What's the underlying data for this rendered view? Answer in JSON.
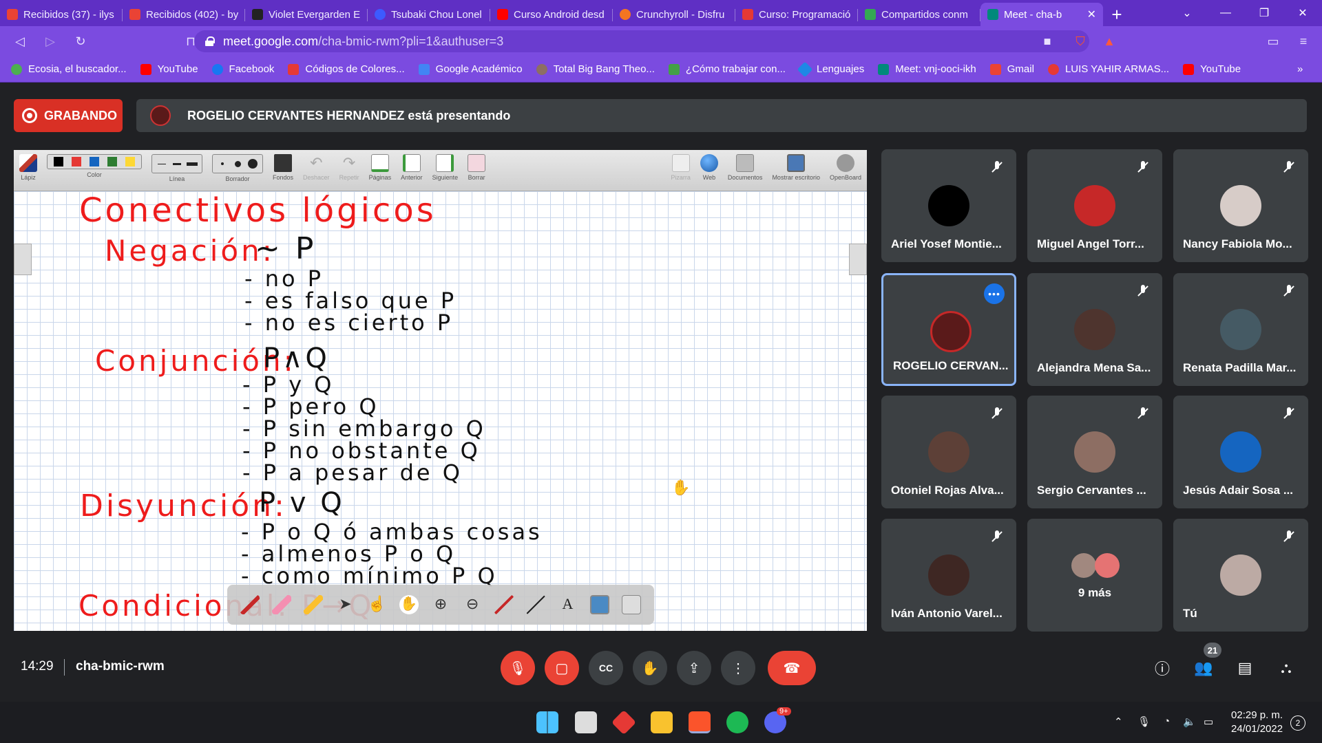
{
  "browser": {
    "tabs": [
      {
        "label": "Recibidos (37) - ilys",
        "color": "#ea4335"
      },
      {
        "label": "Recibidos (402) - by",
        "color": "#ea4335"
      },
      {
        "label": "Violet Evergarden E",
        "color": "#222222"
      },
      {
        "label": "Tsubaki Chou Lonel",
        "color": "#3d5afe"
      },
      {
        "label": "Curso Android desd",
        "color": "#ff0000"
      },
      {
        "label": "Crunchyroll - Disfru",
        "color": "#f47521"
      },
      {
        "label": "Curso: Programació",
        "color": "#e53935"
      },
      {
        "label": "Compartidos conm",
        "color": "#34a853"
      },
      {
        "label": "Meet - cha-b",
        "color": "#00897b",
        "active": true
      }
    ],
    "new_tab": "+",
    "url_host": "meet.google.com",
    "url_path": "/cha-bmic-rwm?pli=1&authuser=3",
    "bookmarks": [
      {
        "label": "Ecosia, el buscador...",
        "color": "#4caf50"
      },
      {
        "label": "YouTube",
        "color": "#ff0000"
      },
      {
        "label": "Facebook",
        "color": "#1877f2"
      },
      {
        "label": "Códigos de Colores...",
        "color": "#e53935"
      },
      {
        "label": "Google Académico",
        "color": "#4285f4"
      },
      {
        "label": "Total Big Bang Theo...",
        "color": "#8d6e63"
      },
      {
        "label": "¿Cómo trabajar con...",
        "color": "#43a047"
      },
      {
        "label": "Lenguajes",
        "color": "#1e88e5"
      },
      {
        "label": "Meet: vnj-ooci-ikh",
        "color": "#00897b"
      },
      {
        "label": "Gmail",
        "color": "#ea4335"
      },
      {
        "label": "LUIS YAHIR ARMAS...",
        "color": "#e53935"
      },
      {
        "label": "YouTube",
        "color": "#ff0000"
      }
    ],
    "more_bookmarks": "»"
  },
  "meet": {
    "recording_label": "GRABANDO",
    "presenting_text": "ROGELIO CERVANTES HERNANDEZ está presentando",
    "meeting_time": "14:29",
    "meeting_code": "cha-bmic-rwm",
    "participant_count": "21"
  },
  "openboard": {
    "tools": [
      {
        "label": "Lápiz"
      },
      {
        "label": "Color"
      },
      {
        "label": "Línea"
      },
      {
        "label": "Borrador"
      },
      {
        "label": "Fondos"
      },
      {
        "label": "Deshacer"
      },
      {
        "label": "Repetir"
      },
      {
        "label": "Páginas"
      },
      {
        "label": "Anterior"
      },
      {
        "label": "Siguiente"
      },
      {
        "label": "Borrar"
      }
    ],
    "right_tools": [
      {
        "label": "Pizarra"
      },
      {
        "label": "Web"
      },
      {
        "label": "Documentos"
      },
      {
        "label": "Mostrar escritorio"
      },
      {
        "label": "OpenBoard"
      }
    ],
    "colors": [
      "#000000",
      "#e53935",
      "#1565c0",
      "#2e7d32",
      "#fdd835"
    ]
  },
  "whiteboard": {
    "title": "Conectivos lógicos",
    "negacion": "Negación:",
    "negacion_sym": "∼ P",
    "neg_items": [
      "- no P",
      "- es falso que P",
      "- no es cierto P"
    ],
    "conjuncion": "Conjunción:",
    "conjuncion_sym": "P∧Q",
    "conj_items": [
      "- P y Q",
      "- P pero Q",
      "- P sin embargo Q",
      "- P no obstante Q",
      "- P a pesar de Q"
    ],
    "disyuncion": "Disyunción:",
    "disyuncion_sym": "P v Q",
    "disy_items": [
      "- P o Q ó ambas cosas",
      "- almenos P o Q",
      "- como mínimo P Q"
    ],
    "condicional": "Condicional: P→Q"
  },
  "participants": [
    {
      "name": "Ariel Yosef Montie...",
      "avatar_color": "#000000"
    },
    {
      "name": "Miguel Angel Torr...",
      "avatar_color": "#c62828"
    },
    {
      "name": "Nancy Fabiola Mo...",
      "avatar_color": "#d7ccc8"
    },
    {
      "name": "ROGELIO CERVAN...",
      "avatar_color": "#5a1a1a",
      "active": true
    },
    {
      "name": "Alejandra Mena Sa...",
      "avatar_color": "#4e342e"
    },
    {
      "name": "Renata Padilla Mar...",
      "avatar_color": "#455a64"
    },
    {
      "name": "Otoniel Rojas Alva...",
      "avatar_color": "#5d4037"
    },
    {
      "name": "Sergio Cervantes ...",
      "avatar_color": "#8d6e63"
    },
    {
      "name": "Jesús Adair Sosa ...",
      "avatar_color": "#1565c0"
    },
    {
      "name": "Iván Antonio Varel...",
      "avatar_color": "#3e2723"
    },
    {
      "name": "9 más",
      "avatar_color": "#a1887f"
    },
    {
      "name": "Tú",
      "avatar_color": "#bcaaa4"
    }
  ],
  "taskbar": {
    "time": "02:29 p. m.",
    "date": "24/01/2022",
    "notifications": "2",
    "discord_badge": "9+"
  },
  "colors": {
    "tab_bar": "#5f2fc4",
    "toolbar": "#7b4be0",
    "meet_bg": "#202124",
    "tile_bg": "#3c4043",
    "danger": "#ea4335",
    "accent": "#8ab4f8"
  }
}
